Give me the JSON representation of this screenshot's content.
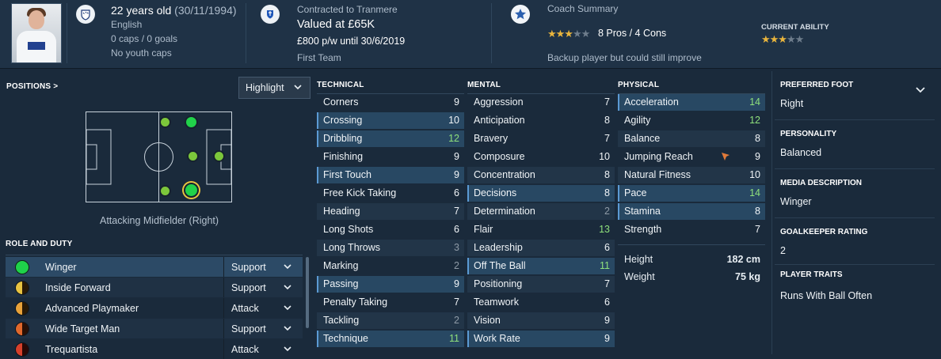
{
  "header": {
    "age_text": "22 years old",
    "dob_text": "(30/11/1994)",
    "nationality": "English",
    "caps": "0 caps / 0 goals",
    "youth_caps": "No youth caps",
    "contract_label": "Contracted to Tranmere",
    "value": "Valued at £65K",
    "wage": "£800 p/w until 30/6/2019",
    "squad": "First Team",
    "coach_title": "Coach Summary",
    "coach_stars": 3,
    "coach_stars_total": 5,
    "pros_cons": "8 Pros / 4 Cons",
    "current_ability_label": "CURRENT ABILITY",
    "ca_stars": 3,
    "ca_stars_total": 5,
    "coach_note": "Backup player but could still improve"
  },
  "positions": {
    "label": "POSITIONS >",
    "dropdown": "Highlight",
    "position_caption": "Attacking Midfielder (Right)"
  },
  "role_duty": {
    "label": "ROLE AND DUTY",
    "roles": [
      {
        "name": "Winger",
        "duty": "Support",
        "suitability": "natural"
      },
      {
        "name": "Inside Forward",
        "duty": "Support",
        "suitability": "accomplished"
      },
      {
        "name": "Advanced Playmaker",
        "duty": "Attack",
        "suitability": "accomplished"
      },
      {
        "name": "Wide Target Man",
        "duty": "Support",
        "suitability": "competent"
      },
      {
        "name": "Trequartista",
        "duty": "Attack",
        "suitability": "competent"
      }
    ]
  },
  "technical": {
    "label": "TECHNICAL",
    "attributes": [
      {
        "name": "Corners",
        "value": "9"
      },
      {
        "name": "Crossing",
        "value": "10"
      },
      {
        "name": "Dribbling",
        "value": "12"
      },
      {
        "name": "Finishing",
        "value": "9"
      },
      {
        "name": "First Touch",
        "value": "9"
      },
      {
        "name": "Free Kick Taking",
        "value": "6"
      },
      {
        "name": "Heading",
        "value": "7"
      },
      {
        "name": "Long Shots",
        "value": "6"
      },
      {
        "name": "Long Throws",
        "value": "3"
      },
      {
        "name": "Marking",
        "value": "2"
      },
      {
        "name": "Passing",
        "value": "9"
      },
      {
        "name": "Penalty Taking",
        "value": "7"
      },
      {
        "name": "Tackling",
        "value": "2"
      },
      {
        "name": "Technique",
        "value": "11"
      }
    ]
  },
  "mental": {
    "label": "MENTAL",
    "attributes": [
      {
        "name": "Aggression",
        "value": "7"
      },
      {
        "name": "Anticipation",
        "value": "8"
      },
      {
        "name": "Bravery",
        "value": "7"
      },
      {
        "name": "Composure",
        "value": "10"
      },
      {
        "name": "Concentration",
        "value": "8"
      },
      {
        "name": "Decisions",
        "value": "8"
      },
      {
        "name": "Determination",
        "value": "2"
      },
      {
        "name": "Flair",
        "value": "13"
      },
      {
        "name": "Leadership",
        "value": "6"
      },
      {
        "name": "Off The Ball",
        "value": "11"
      },
      {
        "name": "Positioning",
        "value": "7"
      },
      {
        "name": "Teamwork",
        "value": "6"
      },
      {
        "name": "Vision",
        "value": "9"
      },
      {
        "name": "Work Rate",
        "value": "9"
      }
    ]
  },
  "physical": {
    "label": "PHYSICAL",
    "attributes": [
      {
        "name": "Acceleration",
        "value": "14"
      },
      {
        "name": "Agility",
        "value": "12"
      },
      {
        "name": "Balance",
        "value": "8"
      },
      {
        "name": "Jumping Reach",
        "value": "9"
      },
      {
        "name": "Natural Fitness",
        "value": "10"
      },
      {
        "name": "Pace",
        "value": "14"
      },
      {
        "name": "Stamina",
        "value": "8"
      },
      {
        "name": "Strength",
        "value": "7"
      }
    ],
    "height_label": "Height",
    "height_value": "182 cm",
    "weight_label": "Weight",
    "weight_value": "75 kg"
  },
  "info": {
    "foot_label": "PREFERRED FOOT",
    "foot_value": "Right",
    "personality_label": "PERSONALITY",
    "personality_value": "Balanced",
    "media_label": "MEDIA DESCRIPTION",
    "media_value": "Winger",
    "gk_label": "GOALKEEPER RATING",
    "gk_value": "2",
    "traits_label": "PLAYER TRAITS",
    "traits_value": "Runs With Ball Often"
  },
  "colors": {
    "background": "#1a2a3b",
    "highlight_row": "#284863",
    "green_value": "#8fe07c",
    "star_gold": "#e9b53d"
  }
}
